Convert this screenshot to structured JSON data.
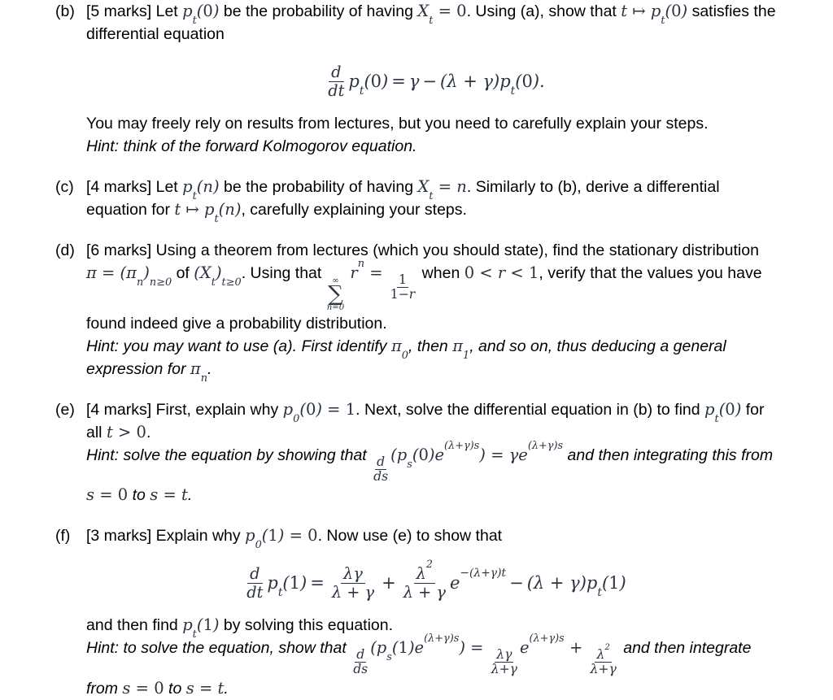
{
  "document": {
    "type": "exam-question-sheet",
    "background_color": "#ffffff",
    "text_color": "#000000",
    "math_color": "#2b3340"
  },
  "items": [
    {
      "label": "(b)",
      "marks": "[5 marks]",
      "lead_text_1": " Let ",
      "math_pt0_a": "p_t(0)",
      "lead_text_2": " be the probability of having ",
      "math_Xt": "X_t",
      "math_eq0": " = 0",
      "lead_text_3": ". Using (a), show that ",
      "math_t": "t",
      "math_mapsto": "↦",
      "math_pt0_b": "p_t(0)",
      "lead_text_4": " satisfies the differential equation",
      "display_equation": "d/dt p_t(0) = γ − (λ + γ) p_t(0).",
      "after_text": "You may freely rely on results from lectures, but you need to carefully explain your steps.",
      "hint": "Hint: think of the forward Kolmogorov equation."
    },
    {
      "label": "(c)",
      "marks": "[4 marks]",
      "text_1": " Let ",
      "math_ptn_a": "p_t(n)",
      "text_2": " be the probability of having ",
      "math_Xt_eq_n": "X_t = n",
      "text_3": ". Similarly to (b), derive a differential equation for ",
      "math_t": "t",
      "math_mapsto": "↦",
      "math_ptn_b": "p_t(n)",
      "text_4": ", carefully explaining your steps."
    },
    {
      "label": "(d)",
      "marks": "[6 marks]",
      "text_1": " Using a theorem from lectures (which you should state), find the stationary distribution ",
      "math_pi_def": "π = (π_n)_{n≥0}",
      "text_2": " of ",
      "math_Xt_family": "(X_t)_{t≥0}",
      "text_3": ". Using that ",
      "math_sum": "Σ_{n=0}^{∞} r^n = 1/(1−r)",
      "text_4": " when ",
      "math_range": "0 < r < 1",
      "text_5": ", verify that the values you have found indeed give a probability distribution.",
      "hint_1": "Hint: you may want to use (a). First identify ",
      "hint_pi0": "π_0",
      "hint_2": ", then ",
      "hint_pi1": "π_1",
      "hint_3": ", and so on, thus deducing a general expression for ",
      "hint_pin": "π_n",
      "hint_4": "."
    },
    {
      "label": "(e)",
      "marks": "[4 marks]",
      "text_1": " First, explain why ",
      "math_p00": "p_0(0) = 1",
      "text_2": ". Next, solve the differential equation in (b) to find ",
      "math_pt0": "p_t(0)",
      "text_3": " for all ",
      "math_t_pos": "t > 0",
      "text_4": ".",
      "hint_1": "Hint: solve the equation by showing that ",
      "hint_math": "d/ds (p_s(0) e^{(λ+γ)s}) = γ e^{(λ+γ)s}",
      "hint_2": " and then integrating this from ",
      "hint_s0": "s = 0",
      "hint_3": " to ",
      "hint_st": "s = t",
      "hint_4": "."
    },
    {
      "label": "(f)",
      "marks": "[3 marks]",
      "text_1": " Explain why ",
      "math_p01": "p_0(1) = 0",
      "text_2": ". Now use (e) to show that",
      "display_equation": "d/dt p_t(1) = λγ/(λ+γ) + λ²/(λ+γ) e^{-(λ+γ)t} − (λ+γ) p_t(1)",
      "after_text_1": "and then find ",
      "after_math": "p_t(1)",
      "after_text_2": " by solving this equation.",
      "hint_1": "Hint: to solve the equation, show that ",
      "hint_math": "d/ds (p_s(1) e^{(λ+γ)s}) = λγ/(λ+γ) e^{(λ+γ)s} + λ²/(λ+γ)",
      "hint_2": " and then integrate from ",
      "hint_s0": "s = 0",
      "hint_3": " to ",
      "hint_st": "s = t",
      "hint_4": "."
    }
  ],
  "symbols": {
    "lambda": "λ",
    "gamma": "γ",
    "pi": "π",
    "infinity": "∞",
    "sigma_sum": "∑",
    "mapsto": "↦",
    "minus": "−",
    "geq": "≥"
  }
}
